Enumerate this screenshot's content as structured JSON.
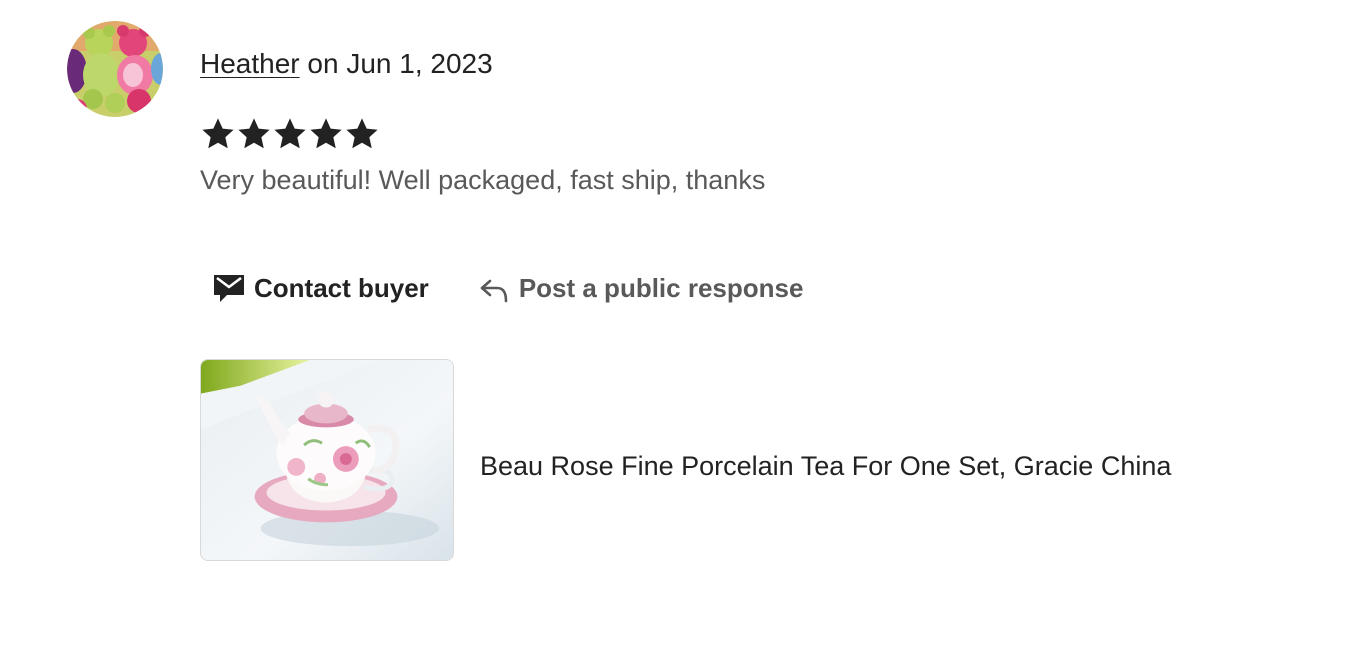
{
  "review": {
    "reviewer_name": "Heather",
    "date_text": " on Jun 1, 2023",
    "rating": 5,
    "text": "Very beautiful! Well packaged, fast ship, thanks",
    "avatar_icon": "avatar-photo-teddy-bears"
  },
  "actions": {
    "contact_label": "Contact buyer",
    "contact_icon": "envelope-icon",
    "post_label": "Post a public response",
    "post_icon": "reply-arrow-icon"
  },
  "listing": {
    "title": "Beau Rose Fine Porcelain Tea For One Set, Gracie China",
    "image_icon": "teapot-product-photo"
  },
  "colors": {
    "primary_text": "#222222",
    "secondary_text": "#595959",
    "star": "#222222",
    "border": "#d8d8d8"
  }
}
